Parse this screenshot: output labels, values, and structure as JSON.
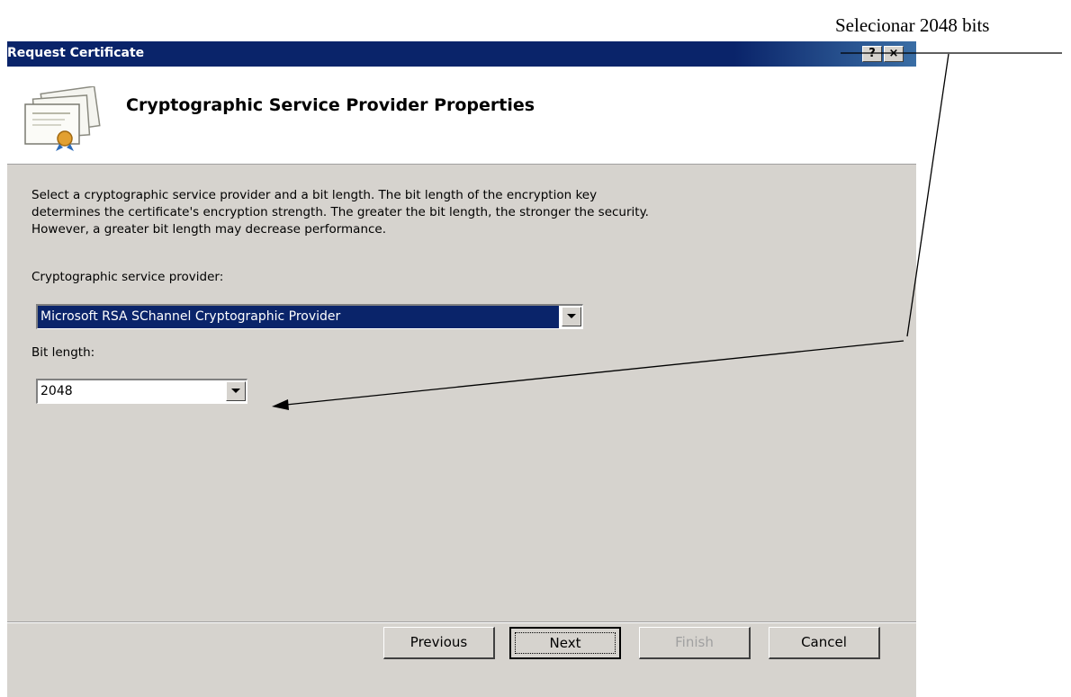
{
  "annotation": {
    "text": "Selecionar 2048 bits"
  },
  "window": {
    "title": "Request Certificate",
    "help_label": "?",
    "close_label": "×"
  },
  "header": {
    "title": "Cryptographic Service Provider Properties"
  },
  "description": {
    "line1": "Select a cryptographic service provider and a bit length. The bit length of the encryption key",
    "line2": "determines the certificate's encryption strength. The greater the bit length, the stronger the security.",
    "line3": "However, a greater bit length may decrease performance."
  },
  "csp": {
    "label": "Cryptographic service provider:",
    "value": "Microsoft RSA SChannel Cryptographic Provider"
  },
  "bit_length": {
    "label": "Bit length:",
    "value": "2048"
  },
  "buttons": {
    "previous": "Previous",
    "next": "Next",
    "finish": "Finish",
    "cancel": "Cancel"
  }
}
